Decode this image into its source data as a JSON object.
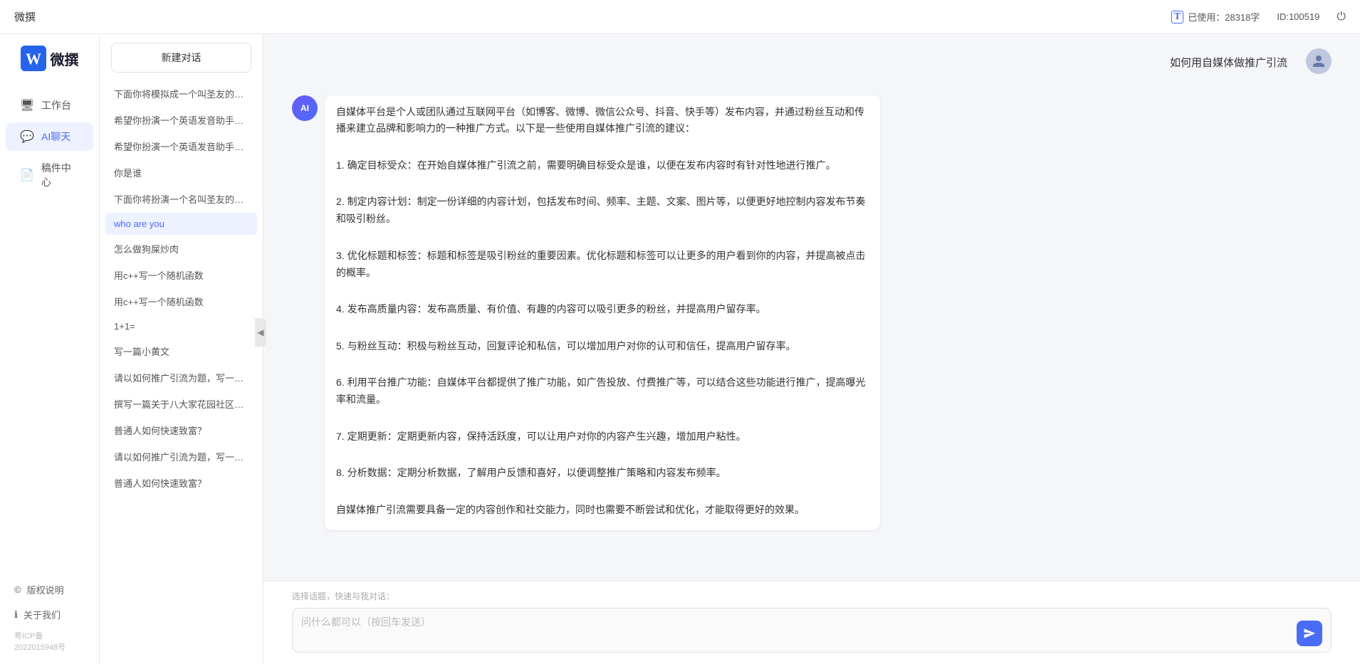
{
  "topbar": {
    "title": "微撰",
    "usage_label": "已使用：28318字",
    "id_label": "ID:100519",
    "usage_icon": "ℹ"
  },
  "sidebar_left": {
    "brand_name": "微撰",
    "nav_items": [
      {
        "id": "workspace",
        "label": "工作台",
        "icon": "🖥"
      },
      {
        "id": "ai-chat",
        "label": "AI聊天",
        "icon": "💬",
        "active": true
      },
      {
        "id": "drafts",
        "label": "稿件中心",
        "icon": "📄"
      }
    ],
    "bottom_items": [
      {
        "id": "copyright",
        "label": "版权说明",
        "icon": "©"
      },
      {
        "id": "about",
        "label": "关于我们",
        "icon": "ℹ"
      }
    ],
    "icp": "粤ICP备2022015948号"
  },
  "chat_sidebar": {
    "new_chat_label": "新建对话",
    "history_items": [
      {
        "id": "h1",
        "text": "下面你将模拟成一个叫圣友的程序员，我说...",
        "active": false
      },
      {
        "id": "h2",
        "text": "希望你扮演一个英语发音助手，我提供给你...",
        "active": false
      },
      {
        "id": "h3",
        "text": "希望你扮演一个英语发音助手，我提供给你...",
        "active": false
      },
      {
        "id": "h4",
        "text": "你是谁",
        "active": false
      },
      {
        "id": "h5",
        "text": "下面你将扮演一个名叫圣友的医生",
        "active": false
      },
      {
        "id": "h6",
        "text": "who are you",
        "active": true
      },
      {
        "id": "h7",
        "text": "怎么做狗屎炒肉",
        "active": false
      },
      {
        "id": "h8",
        "text": "用c++写一个随机函数",
        "active": false
      },
      {
        "id": "h9",
        "text": "用c++写一个随机函数",
        "active": false
      },
      {
        "id": "h10",
        "text": "1+1=",
        "active": false
      },
      {
        "id": "h11",
        "text": "写一篇小黄文",
        "active": false
      },
      {
        "id": "h12",
        "text": "请以如何推广引流为题，写一篇大纲",
        "active": false
      },
      {
        "id": "h13",
        "text": "撰写一篇关于八大家花园社区一刻钟便民生...",
        "active": false
      },
      {
        "id": "h14",
        "text": "普通人如何快速致富？",
        "active": false
      },
      {
        "id": "h15",
        "text": "请以如何推广引流为题，写一篇大纲",
        "active": false
      },
      {
        "id": "h16",
        "text": "普通人如何快速致富？",
        "active": false
      }
    ]
  },
  "chat": {
    "messages": [
      {
        "id": "m1",
        "role": "user",
        "text": "如何用自媒体做推广引流",
        "avatar_type": "user"
      },
      {
        "id": "m2",
        "role": "ai",
        "text": "自媒体平台是个人或团队通过互联网平台（如博客、微博、微信公众号、抖音、快手等）发布内容，并通过粉丝互动和传播来建立品牌和影响力的一种推广方式。以下是一些使用自媒体推广引流的建议：\n\n1. 确定目标受众：在开始自媒体推广引流之前，需要明确目标受众是谁，以便在发布内容时有针对性地进行推广。\n\n2. 制定内容计划：制定一份详细的内容计划，包括发布时间、频率、主题、文案、图片等，以便更好地控制内容发布节奏和吸引粉丝。\n\n3. 优化标题和标签：标题和标签是吸引粉丝的重要因素。优化标题和标签可以让更多的用户看到你的内容，并提高被点击的概率。\n\n4. 发布高质量内容：发布高质量、有价值、有趣的内容可以吸引更多的粉丝，并提高用户留存率。\n\n5. 与粉丝互动：积极与粉丝互动，回复评论和私信，可以增加用户对你的认可和信任，提高用户留存率。\n\n6. 利用平台推广功能：自媒体平台都提供了推广功能，如广告投放、付费推广等，可以结合这些功能进行推广，提高曝光率和流量。\n\n7. 定期更新：定期更新内容，保持活跃度，可以让用户对你的内容产生兴趣，增加用户粘性。\n\n8. 分析数据：定期分析数据，了解用户反馈和喜好，以便调整推广策略和内容发布频率。\n\n自媒体推广引流需要具备一定的内容创作和社交能力，同时也需要不断尝试和优化，才能取得更好的效果。",
        "avatar_type": "ai"
      }
    ],
    "input_placeholder": "问什么都可以（按回车发送）",
    "quick_topics_label": "选择话题，快速与我对话："
  }
}
